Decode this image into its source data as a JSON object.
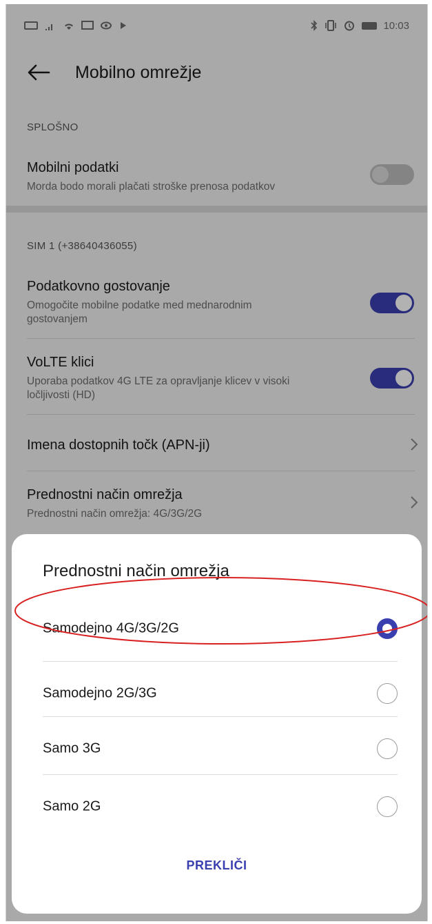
{
  "status_bar": {
    "left_icons": [
      "nfc-icon",
      "signal-icon",
      "wifi-icon",
      "cast-icon",
      "eye-icon",
      "data-icon"
    ],
    "right_icons": [
      "bluetooth-icon",
      "vibrate-icon",
      "alarm-icon",
      "battery-icon"
    ],
    "time": "10:03"
  },
  "header": {
    "title": "Mobilno omrežje"
  },
  "general": {
    "section": "SPLOŠNO",
    "mobile_data": {
      "title": "Mobilni podatki",
      "subtitle": "Morda bodo morali plačati stroške prenosa podatkov",
      "enabled": false
    }
  },
  "sim": {
    "section": "SIM 1 (+38640436055)",
    "roaming": {
      "title": "Podatkovno gostovanje",
      "subtitle_line1": "Omogočite mobilne podatke med mednarodnim",
      "subtitle_line2": "gostovanjem",
      "enabled": true
    },
    "volte": {
      "title": "VoLTE klici",
      "subtitle_line1": "Uporaba podatkov 4G LTE za opravljanje klicev v visoki",
      "subtitle_line2": "ločljivosti (HD)",
      "enabled": true
    },
    "apn": {
      "title": "Imena dostopnih točk (APN-ji)"
    },
    "network_mode": {
      "title": "Prednostni način omrežja",
      "subtitle": "Prednostni način omrežja: 4G/3G/2G"
    }
  },
  "dialog": {
    "title": "Prednostni način omrežja",
    "options": [
      {
        "label": "Samodejno 4G/3G/2G",
        "selected": true
      },
      {
        "label": "Samodejno 2G/3G",
        "selected": false
      },
      {
        "label": "Samo 3G",
        "selected": false
      },
      {
        "label": "Samo 2G",
        "selected": false
      }
    ],
    "cancel_label": "PREKLIČI"
  },
  "colors": {
    "accent": "#3a3fb0",
    "annotation": "#d92020"
  }
}
